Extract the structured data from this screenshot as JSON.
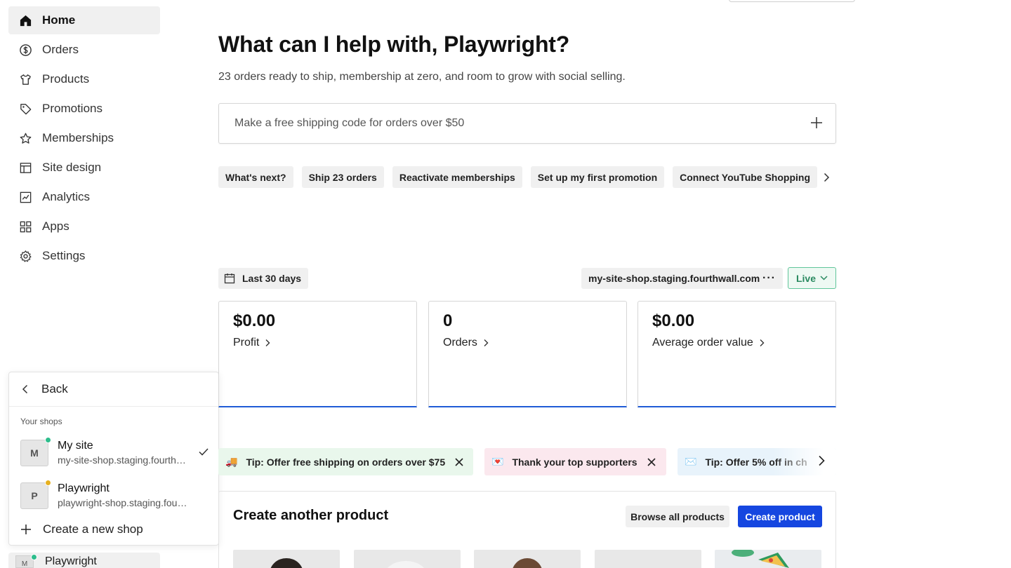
{
  "sidebar": {
    "items": [
      {
        "label": "Home",
        "icon": "home-icon",
        "active": true
      },
      {
        "label": "Orders",
        "icon": "dollar-icon"
      },
      {
        "label": "Products",
        "icon": "shirt-icon"
      },
      {
        "label": "Promotions",
        "icon": "tag-icon"
      },
      {
        "label": "Memberships",
        "icon": "star-icon"
      },
      {
        "label": "Site design",
        "icon": "layout-icon"
      },
      {
        "label": "Analytics",
        "icon": "chart-icon"
      },
      {
        "label": "Apps",
        "icon": "grid-icon"
      },
      {
        "label": "Settings",
        "icon": "gear-icon"
      }
    ]
  },
  "shop_switcher": {
    "back_label": "Back",
    "section_label": "Your shops",
    "shops": [
      {
        "initial": "M",
        "name": "My site",
        "url": "my-site-shop.staging.fourthwall.com",
        "status_color": "#2ebd8c",
        "selected": true
      },
      {
        "initial": "P",
        "name": "Playwright",
        "url": "playwright-shop.staging.fourthwall.com",
        "status_color": "#e6b020",
        "selected": false
      }
    ],
    "create_label": "Create a new shop",
    "current_shop": {
      "initial": "M",
      "name": "Playwright"
    }
  },
  "main": {
    "headline": "What can I help with, Playwright?",
    "subtitle": "23 orders ready to ship, membership at zero, and room to grow with social selling.",
    "prompt_placeholder": "Make a free shipping code for orders over $50",
    "suggestions": [
      "What's next?",
      "Ship 23 orders",
      "Reactivate memberships",
      "Set up my first promotion",
      "Connect YouTube Shopping"
    ],
    "date_range": "Last 30 days",
    "domain": "my-site-shop.staging.fourthwall.com",
    "more_symbol": "···",
    "live_label": "Live",
    "stats": [
      {
        "value": "$0.00",
        "label": "Profit"
      },
      {
        "value": "0",
        "label": "Orders"
      },
      {
        "value": "$0.00",
        "label": "Average order value"
      }
    ],
    "tips": [
      {
        "emoji": "🚚",
        "text": "Tip: Offer free shipping on orders over $75"
      },
      {
        "emoji": "💌",
        "text": "Thank your top supporters"
      },
      {
        "emoji": "✉️",
        "text": "Tip: Offer 5% off in ch"
      }
    ],
    "create_section": {
      "title": "Create another product",
      "browse_label": "Browse all products",
      "create_label": "Create product"
    }
  },
  "colors": {
    "accent": "#1546e0",
    "stat_underline": "#1f5bd6",
    "live_green": "#2a8a60"
  }
}
